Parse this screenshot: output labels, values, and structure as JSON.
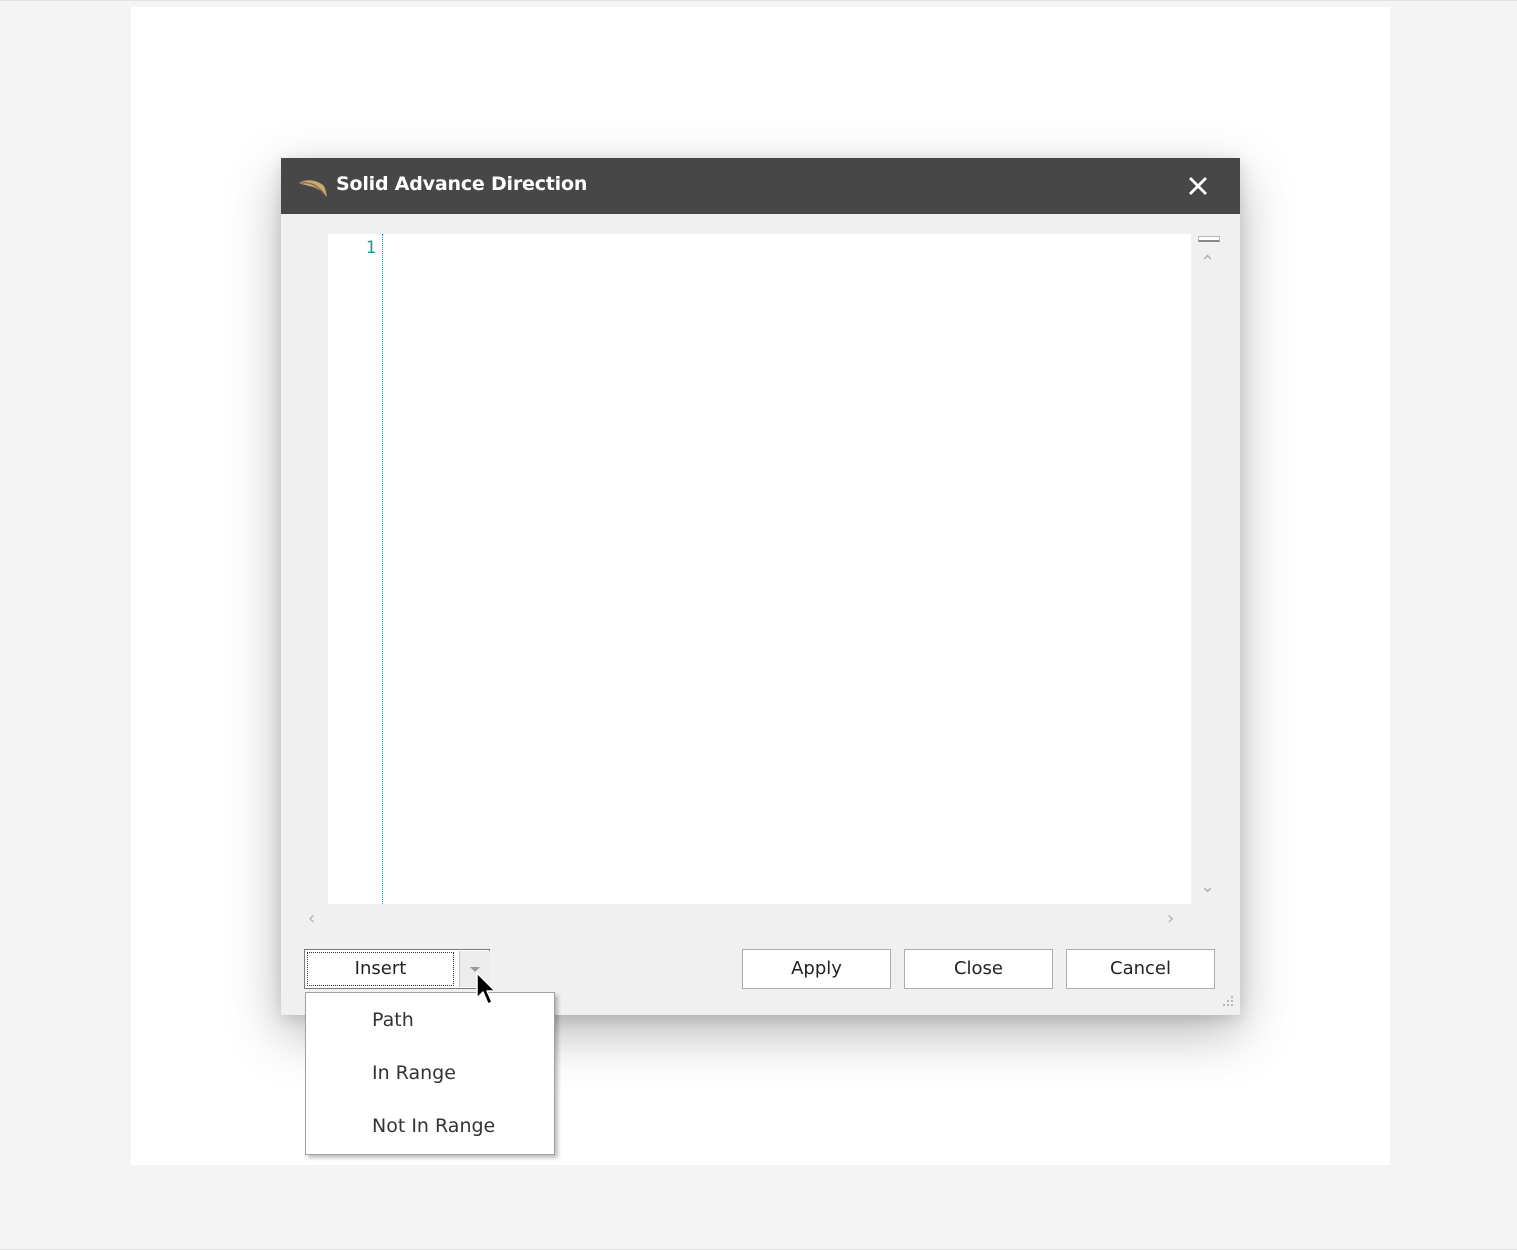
{
  "dialog": {
    "title": "Solid Advance Direction",
    "title_icon": "feather-icon",
    "close_icon": "close-icon"
  },
  "editor": {
    "line_numbers": [
      "1"
    ],
    "content": ""
  },
  "buttons": {
    "insert_label": "Insert",
    "apply_label": "Apply",
    "close_label": "Close",
    "cancel_label": "Cancel"
  },
  "insert_menu": {
    "items": [
      {
        "label": "Path"
      },
      {
        "label": "In Range"
      },
      {
        "label": "Not In Range"
      }
    ]
  },
  "colors": {
    "titlebar": "#474747",
    "dialog_bg": "#f0f0f0",
    "line_number": "#2a8f8f"
  }
}
